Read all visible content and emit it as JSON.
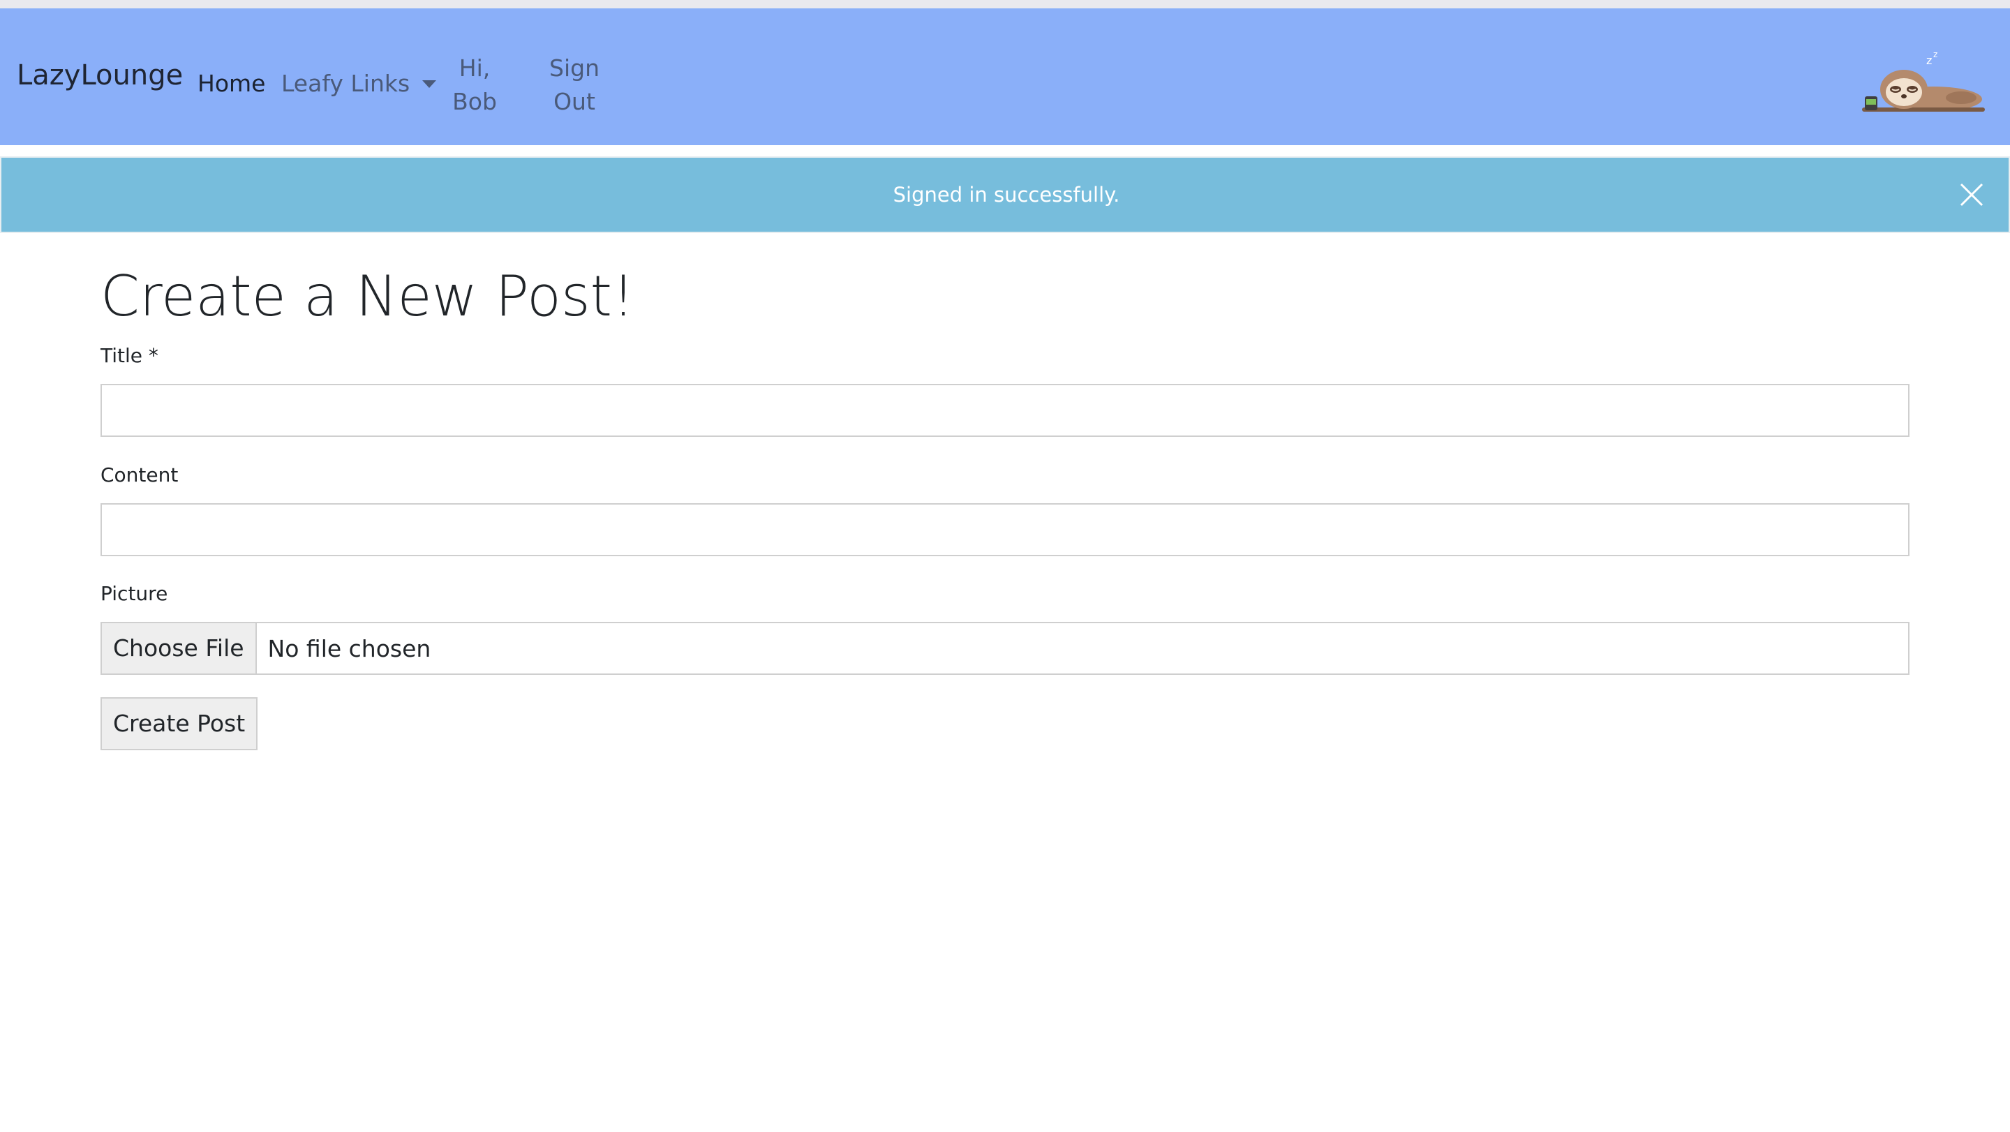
{
  "navbar": {
    "brand": "LazyLounge",
    "links": {
      "home": "Home",
      "leafy_links": "Leafy Links",
      "greeting_line1": "Hi,",
      "greeting_line2": "Bob",
      "signout_line1": "Sign",
      "signout_line2": "Out"
    },
    "logo_icon": "sleeping-sloth-icon",
    "background_color": "#8aaff9"
  },
  "alert": {
    "message": "Signed in successfully.",
    "close_icon": "close-icon",
    "background_color": "#77bddc"
  },
  "form": {
    "heading": "Create a New Post!",
    "title_label": "Title *",
    "title_value": "",
    "content_label": "Content",
    "content_value": "",
    "picture_label": "Picture",
    "choose_file_label": "Choose File",
    "file_status": "No file chosen",
    "submit_label": "Create Post"
  }
}
